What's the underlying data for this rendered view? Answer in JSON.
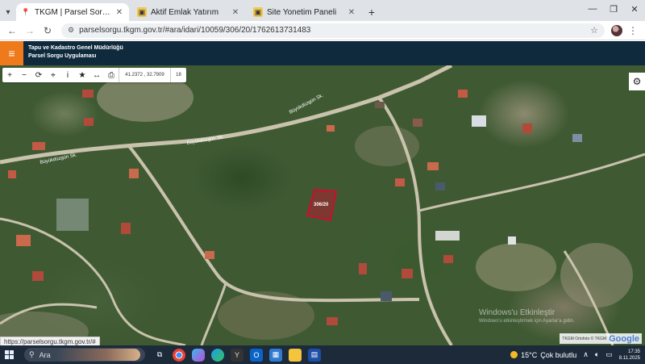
{
  "browser": {
    "tabs": [
      {
        "title": "TKGM | Parsel Sorgu Uygulaması",
        "active": true
      },
      {
        "title": "Aktif Emlak Yatırım",
        "active": false
      },
      {
        "title": "Site Yonetim Paneli",
        "active": false
      }
    ],
    "url": "parselsorgu.tkgm.gov.tr/#ara/idari/10059/306/20/1762613731483",
    "status_url": "https://parselsorgu.tkgm.gov.tr/#"
  },
  "app": {
    "org_name": "Tapu ve Kadastro Genel Müdürlüğü",
    "app_name": "Parsel Sorgu Uygulaması",
    "menu_icon": "hamburger-icon",
    "accent_color": "#ee7a1c",
    "header_color": "#0f2a3d"
  },
  "map": {
    "coords": "41.2372 , 32.7909",
    "zoom": "18",
    "parcel_label": "306/20",
    "roads": [
      {
        "label": "Büyükdüzgün Sk."
      },
      {
        "label": "Büyükdüzgün Sk."
      },
      {
        "label": "Büyükdüzgün Sk."
      }
    ],
    "parcel_color": "#c8102e",
    "attribution": "TKGM Ortofoto © TKGM",
    "google_logo": "Google",
    "watermark_title": "Windows'u Etkinleştir",
    "watermark_sub": "Windows'u etkinleştirmek için Ayarlar'a gidin."
  },
  "taskbar": {
    "search_text": "Ara",
    "weather_temp": "15°C",
    "weather_desc": "Çok bulutlu",
    "time": "17:35",
    "date": "8.11.2025"
  }
}
